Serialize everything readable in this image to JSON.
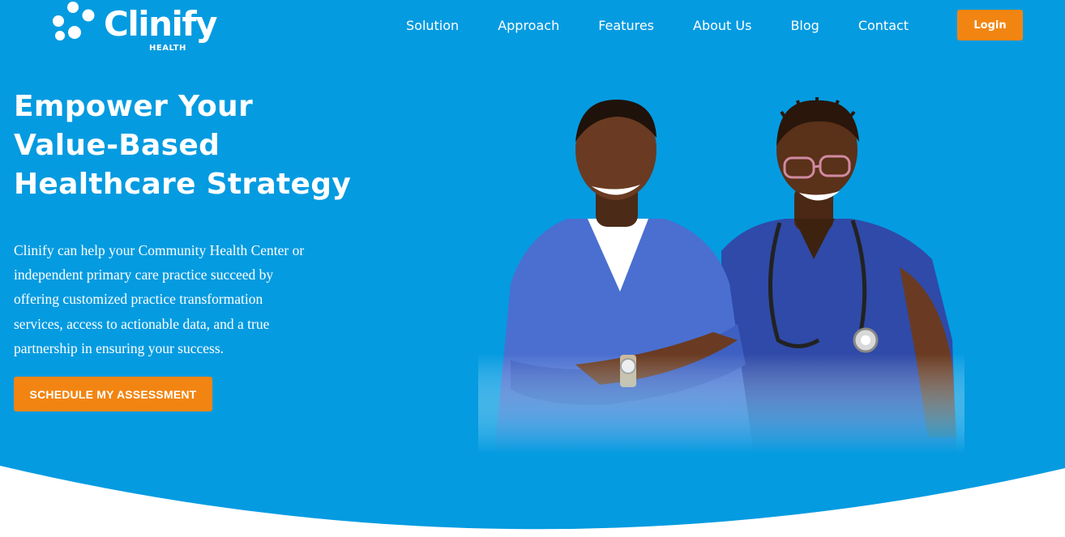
{
  "brand": {
    "name": "Clinify",
    "tagline": "HEALTH"
  },
  "nav": {
    "items": [
      {
        "label": "Solution"
      },
      {
        "label": "Approach"
      },
      {
        "label": "Features"
      },
      {
        "label": "About Us"
      },
      {
        "label": "Blog"
      },
      {
        "label": "Contact"
      }
    ],
    "login_label": "Login"
  },
  "hero": {
    "headline_lines": [
      "Empower Your",
      "Value-Based",
      "Healthcare Strategy"
    ],
    "description_lines": [
      "Clinify can help your Community Health Center or",
      "independent primary care practice succeed by",
      "offering customized practice transformation",
      "services, access to actionable data, and a true",
      "partnership in ensuring your success."
    ],
    "cta_label": "SCHEDULE MY ASSESSMENT"
  },
  "colors": {
    "hero_background": "#049be1",
    "accent": "#f28512",
    "text": "#ffffff",
    "page_background": "#ffffff"
  },
  "icons": {
    "logo_mark": "five-dots-logo-icon"
  }
}
